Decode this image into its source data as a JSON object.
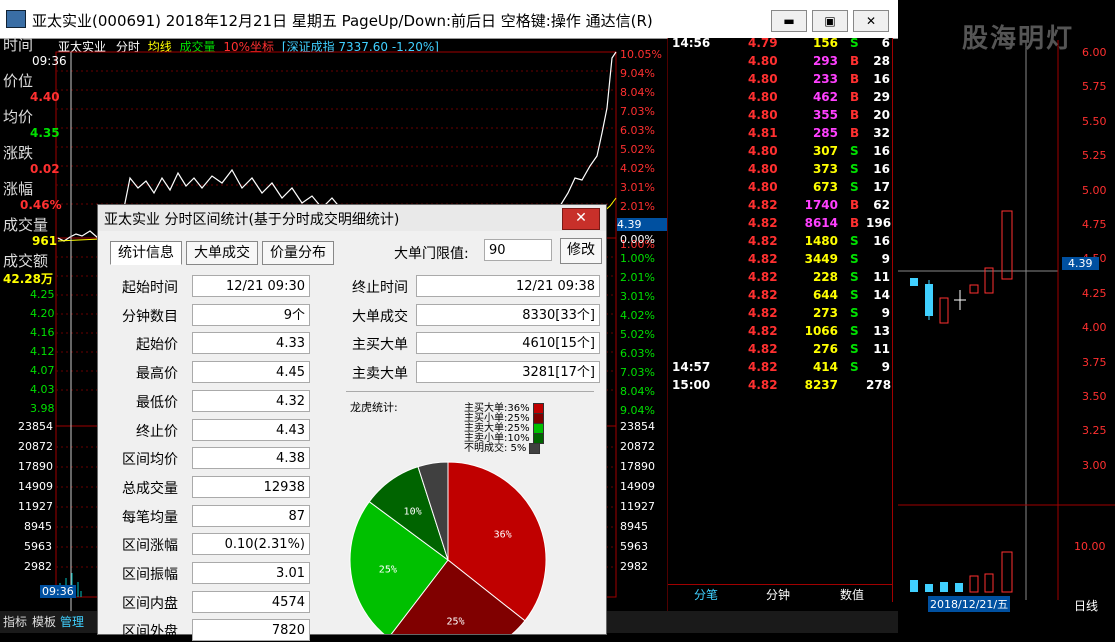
{
  "window": {
    "title": "亚太实业(000691) 2018年12月21日 星期五 PageUp/Down:前后日 空格键:操作 通达信(R)",
    "minimize": "▬",
    "maximize": "▣",
    "close": "✕"
  },
  "watermark": "股海明灯",
  "chart_header": {
    "stock": "亚太实业",
    "mode": "分时",
    "avg_line": "均线",
    "volume": "成交量",
    "coord": "10%坐标",
    "index": "[深证成指 7337.60 -1.20%]"
  },
  "info": {
    "time_label": "时间",
    "time_value": "09:36",
    "price_label": "价位",
    "price_value": "4.40",
    "avg_label": "均价",
    "avg_value": "4.35",
    "change_label": "涨跌",
    "change_value": "0.02",
    "pct_label": "涨幅",
    "pct_value": "0.46%",
    "vol_label": "成交量",
    "vol_value": "961",
    "amount_label": "成交额",
    "amount_value": "42.28万"
  },
  "price_axis_left": [
    "4.25",
    "4.20",
    "4.16",
    "4.12",
    "4.07",
    "4.03",
    "3.98"
  ],
  "volume_axis_left": [
    "23854",
    "20872",
    "17890",
    "14909",
    "11927",
    "8945",
    "5963",
    "2982"
  ],
  "pct_axis": [
    "10.05%",
    "9.04%",
    "8.04%",
    "7.03%",
    "6.03%",
    "5.02%",
    "4.02%",
    "3.01%",
    "2.01%",
    "1.00%",
    "0.00%",
    "1.00%",
    "2.01%",
    "3.01%",
    "4.02%",
    "5.02%",
    "6.03%",
    "7.03%",
    "8.04%",
    "9.04%"
  ],
  "volume_axis_right": [
    "23854",
    "20872",
    "17890",
    "14909",
    "11927",
    "8945",
    "5963",
    "2982"
  ],
  "cursor_time": "09:36",
  "price_marker": "4.39",
  "ticks": [
    {
      "time": "14:56",
      "price": "4.79",
      "vol": "156",
      "side": "S",
      "n": "6"
    },
    {
      "time": "",
      "price": "4.80",
      "vol": "293",
      "side": "B",
      "n": "28"
    },
    {
      "time": "",
      "price": "4.80",
      "vol": "233",
      "side": "B",
      "n": "16"
    },
    {
      "time": "",
      "price": "4.80",
      "vol": "462",
      "side": "B",
      "n": "29"
    },
    {
      "time": "",
      "price": "4.80",
      "vol": "355",
      "side": "B",
      "n": "20"
    },
    {
      "time": "",
      "price": "4.81",
      "vol": "285",
      "side": "B",
      "n": "32"
    },
    {
      "time": "",
      "price": "4.80",
      "vol": "307",
      "side": "S",
      "n": "16"
    },
    {
      "time": "",
      "price": "4.80",
      "vol": "373",
      "side": "S",
      "n": "16"
    },
    {
      "time": "",
      "price": "4.80",
      "vol": "673",
      "side": "S",
      "n": "17"
    },
    {
      "time": "",
      "price": "4.82",
      "vol": "1740",
      "side": "B",
      "n": "62"
    },
    {
      "time": "",
      "price": "4.82",
      "vol": "8614",
      "side": "B",
      "n": "196"
    },
    {
      "time": "",
      "price": "4.82",
      "vol": "1480",
      "side": "S",
      "n": "16"
    },
    {
      "time": "",
      "price": "4.82",
      "vol": "3449",
      "side": "S",
      "n": "9"
    },
    {
      "time": "",
      "price": "4.82",
      "vol": "228",
      "side": "S",
      "n": "11"
    },
    {
      "time": "",
      "price": "4.82",
      "vol": "644",
      "side": "S",
      "n": "14"
    },
    {
      "time": "",
      "price": "4.82",
      "vol": "273",
      "side": "S",
      "n": "9"
    },
    {
      "time": "",
      "price": "4.82",
      "vol": "1066",
      "side": "S",
      "n": "13"
    },
    {
      "time": "",
      "price": "4.82",
      "vol": "276",
      "side": "S",
      "n": "11"
    },
    {
      "time": "14:57",
      "price": "4.82",
      "vol": "414",
      "side": "S",
      "n": "9"
    },
    {
      "time": "15:00",
      "price": "4.82",
      "vol": "8237",
      "side": "",
      "n": "278"
    }
  ],
  "tick_tabs": [
    "分笔",
    "分钟",
    "数值"
  ],
  "kline_axis": [
    "6.00",
    "5.75",
    "5.50",
    "5.25",
    "5.00",
    "4.75",
    "4.50",
    "4.25",
    "4.00",
    "3.75",
    "3.50",
    "3.25",
    "3.00"
  ],
  "kline_marker": "4.39",
  "kline_vol_axis": "10.00",
  "kline_date": "2018/12/21/五",
  "kline_period": "日线",
  "bottom_tabs": [
    "指标",
    "模板",
    "管理"
  ],
  "dialog": {
    "title": "亚太实业 分时区间统计(基于分时成交明细统计)",
    "close": "✕",
    "tabs": [
      "统计信息",
      "大单成交",
      "价量分布"
    ],
    "threshold_label": "大单门限值:",
    "threshold_value": "90",
    "modify": "修改",
    "left_fields": [
      {
        "label": "起始时间",
        "value": "12/21 09:30"
      },
      {
        "label": "分钟数目",
        "value": "9个"
      },
      {
        "label": "起始价",
        "value": "4.33"
      },
      {
        "label": "最高价",
        "value": "4.45"
      },
      {
        "label": "最低价",
        "value": "4.32"
      },
      {
        "label": "终止价",
        "value": "4.43"
      },
      {
        "label": "区间均价",
        "value": "4.38"
      },
      {
        "label": "总成交量",
        "value": "12938"
      },
      {
        "label": "每笔均量",
        "value": "87"
      },
      {
        "label": "区间涨幅",
        "value": "0.10(2.31%)"
      },
      {
        "label": "区间振幅",
        "value": "3.01"
      },
      {
        "label": "区间内盘",
        "value": "4574"
      },
      {
        "label": "区间外盘",
        "value": "7820"
      }
    ],
    "right_fields": [
      {
        "label": "终止时间",
        "value": "12/21 09:38"
      },
      {
        "label": "大单成交",
        "value": "8330[33个]"
      },
      {
        "label": "主买大单",
        "value": "4610[15个]"
      },
      {
        "label": "主卖大单",
        "value": "3281[17个]"
      }
    ],
    "dragon_label": "龙虎统计:",
    "legend": [
      {
        "label": "主买大单:36%",
        "color": "#c00000"
      },
      {
        "label": "主买小单:25%",
        "color": "#800000"
      },
      {
        "label": "主卖大单:25%",
        "color": "#00c000"
      },
      {
        "label": "主卖小单:10%",
        "color": "#006400"
      },
      {
        "label": "不明成交: 5%",
        "color": "#404040"
      }
    ],
    "pie": [
      {
        "label": "36%",
        "value": 36,
        "color": "#c00000"
      },
      {
        "label": "25%",
        "value": 25,
        "color": "#800000"
      },
      {
        "label": "25%",
        "value": 25,
        "color": "#00c000"
      },
      {
        "label": "10%",
        "value": 10,
        "color": "#006400"
      },
      {
        "label": "",
        "value": 5,
        "color": "#404040"
      }
    ]
  }
}
